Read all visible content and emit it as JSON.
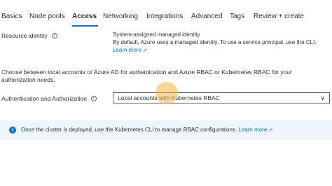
{
  "tabs": [
    {
      "label": "Basics"
    },
    {
      "label": "Node pools"
    },
    {
      "label": "Access"
    },
    {
      "label": "Networking"
    },
    {
      "label": "Integrations"
    },
    {
      "label": "Advanced"
    },
    {
      "label": "Tags"
    },
    {
      "label": "Review + create"
    }
  ],
  "active_tab": "Access",
  "resource_identity": {
    "label": "Resource identity",
    "value_title": "System-assigned managed identity",
    "value_desc": "By default, Azure uses a managed identity. To use a service principal, use the CLI.",
    "learn_more": "Learn more"
  },
  "auth_description": "Choose between local accounts or Azure AD for authentication and Azure RBAC or Kubernetes RBAC for your authorization needs.",
  "auth": {
    "label": "Authentication and Authorization",
    "selected": "Local accounts with Kubernetes RBAC"
  },
  "banner": {
    "text": "Once the cluster is deployed, use the Kubernetes CLI to manage RBAC configurations.",
    "learn_more": "Learn more"
  },
  "icons": {
    "info": "info-icon",
    "external": "external-link-icon",
    "chevron": "chevron-down-icon"
  },
  "colors": {
    "accent": "#0078d4",
    "banner_bg": "#eff6fc",
    "cursor_highlight": "#f2b446"
  }
}
